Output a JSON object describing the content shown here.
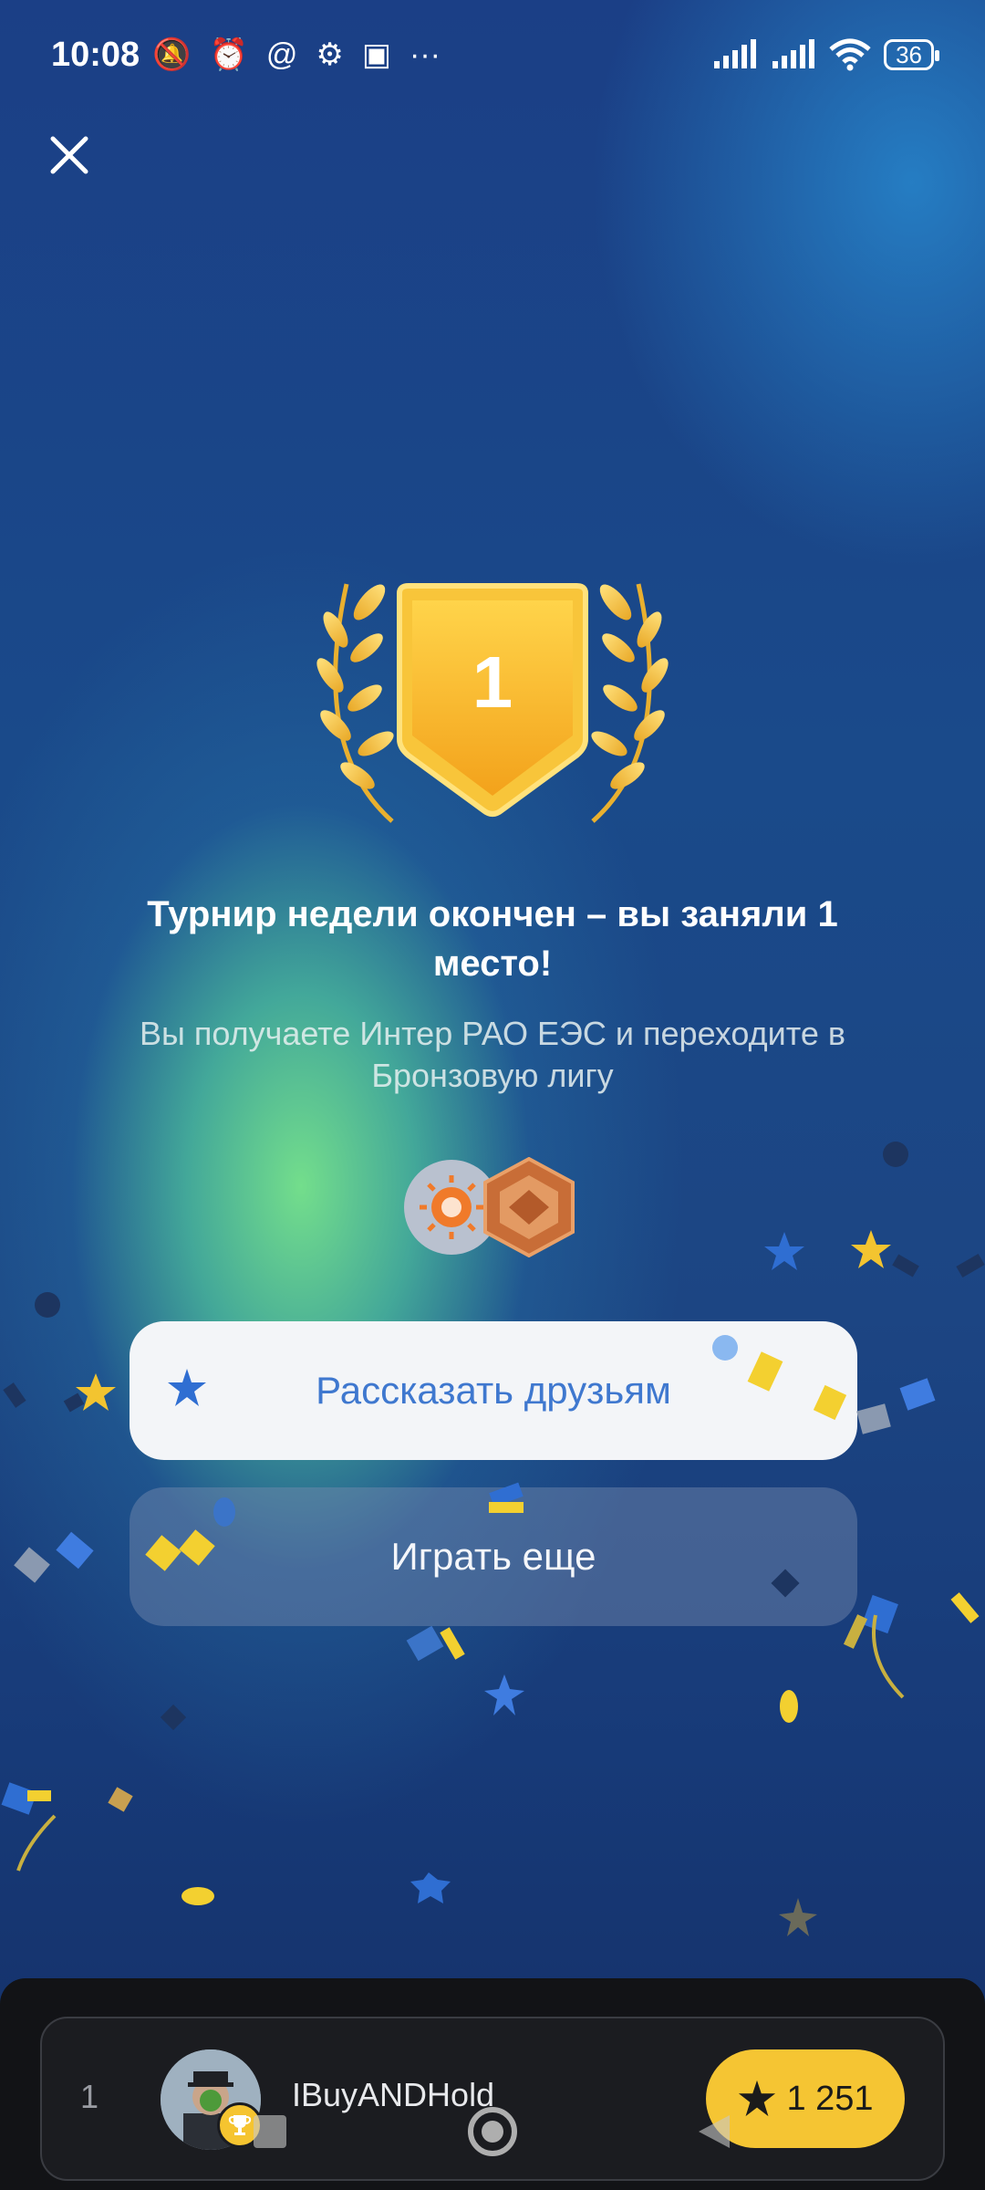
{
  "status_bar": {
    "time": "10:08",
    "battery": "36",
    "icons": [
      "mute-icon",
      "alarm-icon",
      "at-icon",
      "settings-cog-icon",
      "contact-card-icon",
      "more-dots-icon",
      "signal-icon",
      "signal-icon",
      "wifi-icon",
      "battery-icon"
    ],
    "more": "···"
  },
  "trophy": {
    "place": "1",
    "color_gold": "#f6b523"
  },
  "result": {
    "title": "Турнир недели окончен – вы заняли 1 место!",
    "subtitle": "Вы получаете Интер РАО ЕЭС и переходите в Бронзовую лигу"
  },
  "buttons": {
    "share_label": "Рассказать друзьям",
    "play_label": "Играть еще"
  },
  "leaderboard_row": {
    "rank": "1",
    "username": "IBuyANDHold",
    "score": "1 251"
  },
  "colors": {
    "accent_blue": "#3f78cf",
    "score_yellow": "#f5c533",
    "bronze": "#c9753f"
  }
}
